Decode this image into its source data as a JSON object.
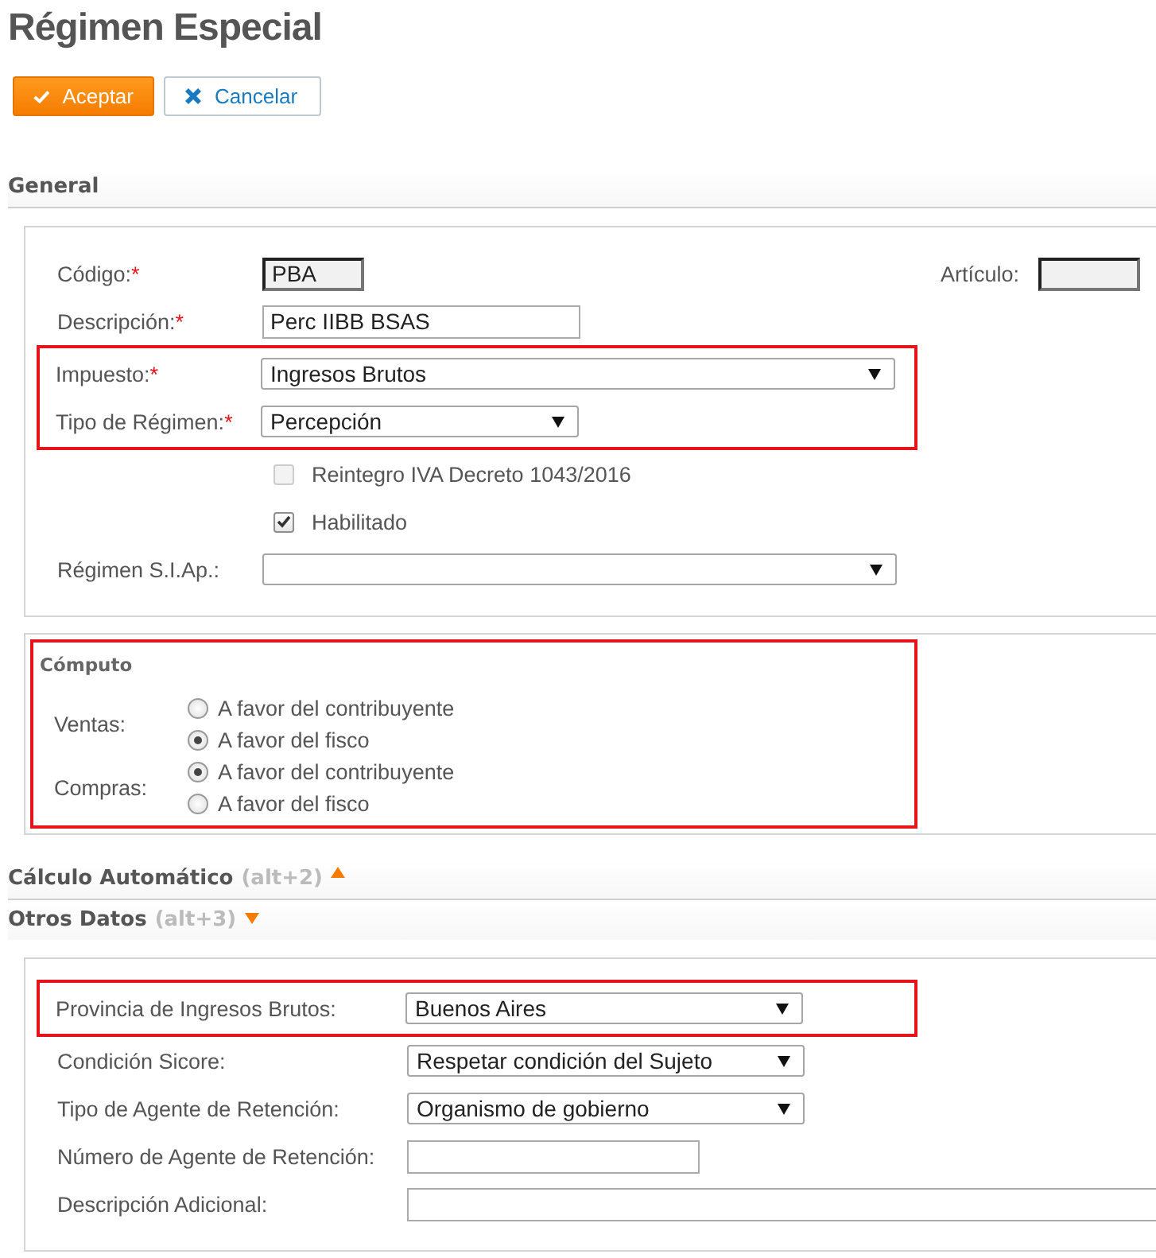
{
  "title": "Régimen Especial",
  "actions": [
    {
      "label": "Aceptar",
      "kind": "primary"
    },
    {
      "label": "Cancelar",
      "kind": "secondary"
    }
  ],
  "general": {
    "heading": "General",
    "groups": [
      {
        "rows": [
          {
            "kind": "text",
            "label": "Código:",
            "marker": "*",
            "value": "PBA",
            "disabled": true,
            "side": {
              "label": "Artículo:",
              "disabled": true
            }
          },
          {
            "kind": "text",
            "label": "Descripción:",
            "marker": "*",
            "value": "Perc IIBB BSAS",
            "disabled": false
          }
        ]
      },
      {
        "highlighted": true,
        "rows": [
          {
            "kind": "select",
            "label": "Impuesto:",
            "marker": "*",
            "value": "Ingresos Brutos"
          },
          {
            "kind": "select",
            "label": "Tipo de Régimen:",
            "marker": "*",
            "value": "Percepción"
          }
        ]
      },
      {
        "rows": [
          {
            "kind": "checkbox",
            "label": "Reintegro IVA Decreto 1043/2016",
            "checked": false,
            "disabled": true
          },
          {
            "kind": "checkbox",
            "label": "Habilitado",
            "checked": true,
            "disabled": false
          },
          {
            "kind": "select",
            "label": "Régimen S.I.Ap.:"
          }
        ]
      }
    ]
  },
  "computo": {
    "title": "Cómputo",
    "highlighted": true,
    "groups": [
      {
        "label": "Ventas:",
        "options": [
          {
            "label": "A favor del contribuyente",
            "selected": false
          },
          {
            "label": "A favor del fisco",
            "selected": true
          }
        ]
      },
      {
        "label": "Compras:",
        "options": [
          {
            "label": "A favor del contribuyente",
            "selected": true
          },
          {
            "label": "A favor del fisco",
            "selected": false
          }
        ]
      }
    ]
  },
  "collapsibles": [
    {
      "title": "Cálculo Automático",
      "shortcut": "(alt+2)",
      "expanded": false
    },
    {
      "title": "Otros Datos",
      "shortcut": "(alt+3)",
      "expanded": true
    }
  ],
  "otros": {
    "groups": [
      {
        "highlighted": true,
        "rows": [
          {
            "kind": "select",
            "label": "Provincia de Ingresos Brutos:",
            "value": "Buenos Aires"
          }
        ]
      },
      {
        "rows": [
          {
            "kind": "select",
            "label": "Condición Sicore:",
            "value": "Respetar condición del Sujeto"
          },
          {
            "kind": "select",
            "label": "Tipo de Agente de Retención:",
            "value": "Organismo de gobierno"
          },
          {
            "kind": "text",
            "label": "Número de Agente de Retención:",
            "disabled": false
          },
          {
            "kind": "text",
            "label": "Descripción Adicional:",
            "disabled": false
          }
        ]
      }
    ]
  }
}
